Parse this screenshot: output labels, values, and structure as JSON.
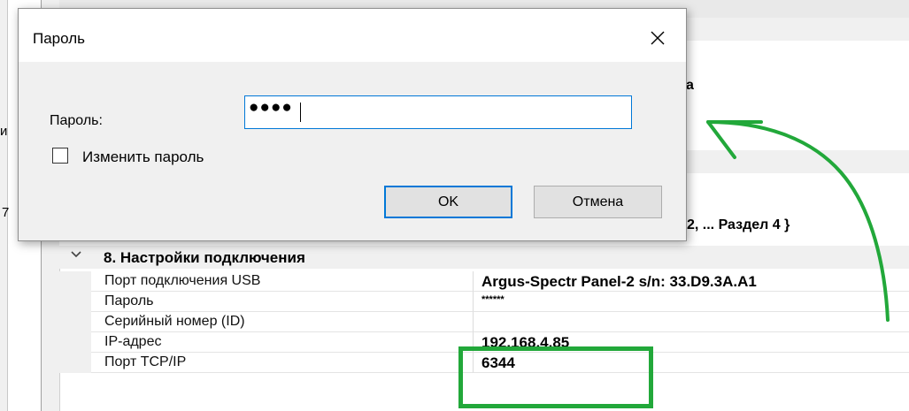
{
  "dialog": {
    "title": "Пароль",
    "password_label": "Пароль:",
    "password_value": "●●●●",
    "change_password_label": "Изменить пароль",
    "change_password_checked": false,
    "ok_label": "OK",
    "cancel_label": "Отмена"
  },
  "background": {
    "fragment_a": "а",
    "fragment_b": "2, ... Раздел 4 }",
    "edge_glyph": "и",
    "edge_glyph2": "7"
  },
  "grid": {
    "category": "8. Настройки подключения",
    "rows": [
      {
        "name": "Порт подключения USB",
        "value": "Argus-Spectr Panel-2 s/n: 33.D9.3A.A1"
      },
      {
        "name": "Пароль",
        "value": "******"
      },
      {
        "name": "Серийный номер (ID)",
        "value": ""
      },
      {
        "name": "IP-адрес",
        "value": "192.168.4.85"
      },
      {
        "name": "Порт TCP/IP",
        "value": "6344"
      }
    ]
  },
  "annotation": {
    "highlight_color": "#22a83a",
    "arrow_color": "#22a83a"
  }
}
